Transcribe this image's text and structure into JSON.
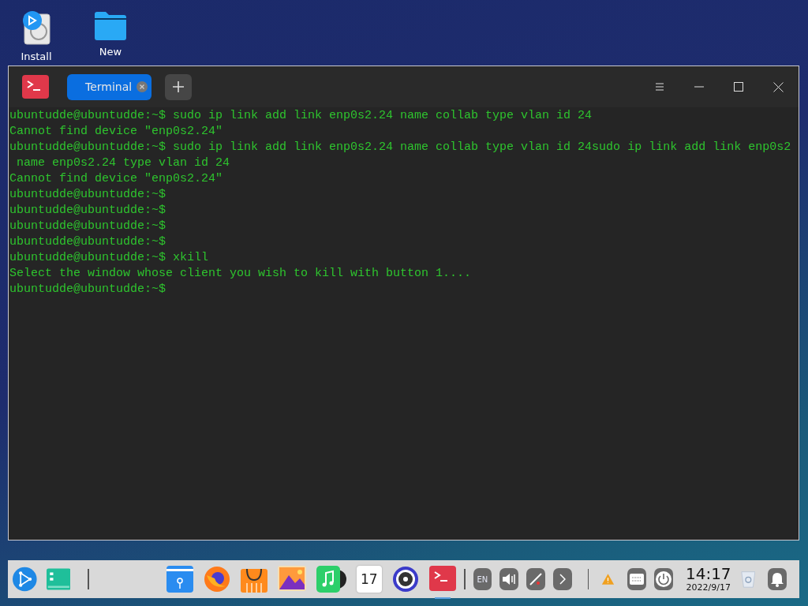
{
  "desktop_icons": [
    {
      "kind": "installer",
      "label": "Install"
    },
    {
      "kind": "folder",
      "label": "New"
    }
  ],
  "window": {
    "tabs": [
      {
        "label": "Terminal",
        "selected": true
      }
    ],
    "lines": [
      "ubuntudde@ubuntudde:~$ sudo ip link add link enp0s2.24 name collab type vlan id 24",
      "Cannot find device \"enp0s2.24\"",
      "ubuntudde@ubuntudde:~$ sudo ip link add link enp0s2.24 name collab type vlan id 24sudo ip link add link enp0s2",
      " name enp0s2.24 type vlan id 24",
      "Cannot find device \"enp0s2.24\"",
      "ubuntudde@ubuntudde:~$",
      "ubuntudde@ubuntudde:~$",
      "ubuntudde@ubuntudde:~$",
      "ubuntudde@ubuntudde:~$",
      "ubuntudde@ubuntudde:~$ xkill",
      "Select the window whose client you wish to kill with button 1....",
      "ubuntudde@ubuntudde:~$"
    ]
  },
  "dock": {
    "left": [
      {
        "kind": "launcher"
      },
      {
        "kind": "multitask"
      }
    ],
    "apps": [
      {
        "kind": "files",
        "active": false
      },
      {
        "kind": "browser",
        "active": false
      },
      {
        "kind": "store",
        "active": false
      },
      {
        "kind": "images",
        "active": false
      },
      {
        "kind": "music",
        "active": false
      },
      {
        "kind": "calendar",
        "day": "17",
        "active": false
      },
      {
        "kind": "settings",
        "active": false
      },
      {
        "kind": "terminal",
        "active": true
      }
    ],
    "tray": [
      {
        "kind": "ime",
        "text": "EN"
      },
      {
        "kind": "volume"
      },
      {
        "kind": "network"
      },
      {
        "kind": "chevron"
      }
    ],
    "system": [
      {
        "kind": "warning"
      },
      {
        "kind": "keyboard"
      },
      {
        "kind": "power"
      }
    ],
    "clock": {
      "time": "14:17",
      "date": "2022/9/17"
    }
  }
}
